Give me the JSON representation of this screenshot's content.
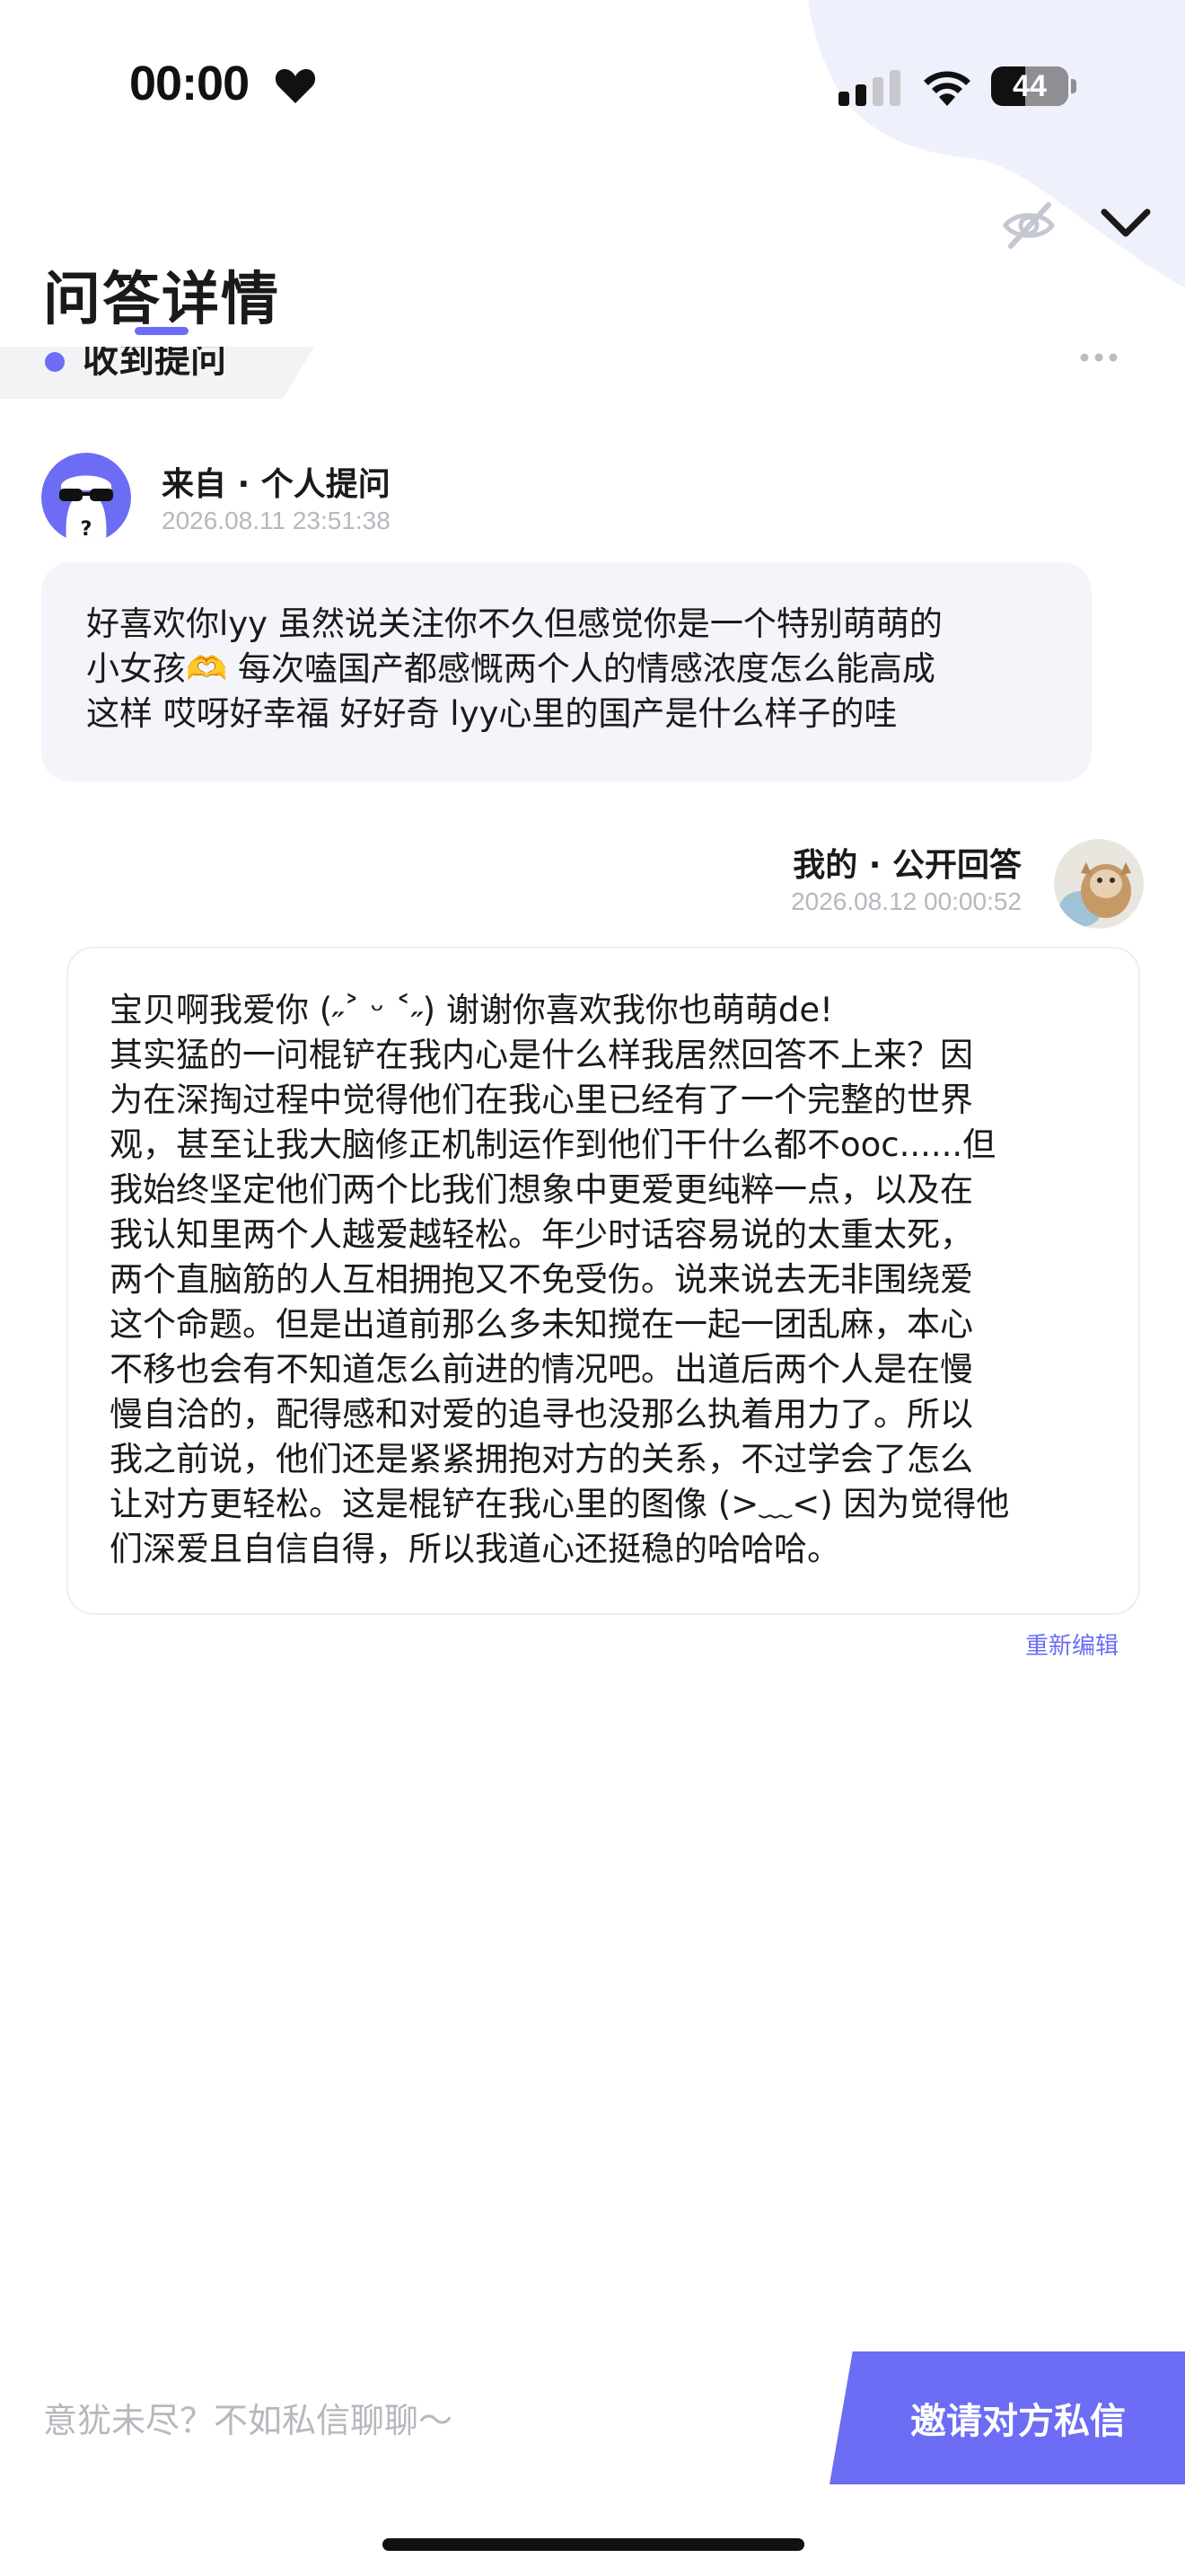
{
  "status_bar": {
    "time": "00:00",
    "battery_level": "44",
    "icons": [
      "heart-icon",
      "signal-icon",
      "wifi-icon",
      "battery-icon"
    ]
  },
  "header": {
    "title": "问答详情",
    "icons": [
      "eye-off-icon",
      "chevron-down-icon"
    ],
    "accent_color": "#6c6cf5"
  },
  "status_tab": {
    "label": "收到提问"
  },
  "question": {
    "source": "来自 · 个人提问",
    "time": "2026.08.11 23:51:38",
    "text": "好喜欢你lyy 虽然说关注你不久但感觉你是一个特别萌萌的\n小女孩🫶 每次嗑国产都感慨两个人的情感浓度怎么能高成\n这样 哎呀好幸福 好好奇 lyy心里的国产是什么样子的哇"
  },
  "answer": {
    "label": "我的 · 公开回答",
    "time": "2026.08.12 00:00:52",
    "text": "宝贝啊我爱你 (˶˃ ᵕ ˂˶) 谢谢你喜欢我你也萌萌de!\n其实猛的一问棍铲在我内心是什么样我居然回答不上来？因\n为在深掏过程中觉得他们在我心里已经有了一个完整的世界\n观，甚至让我大脑修正机制运作到他们干什么都不ooc......但\n我始终坚定他们两个比我们想象中更爱更纯粹一点，以及在\n我认知里两个人越爱越轻松。年少时话容易说的太重太死，\n两个直脑筋的人互相拥抱又不免受伤。说来说去无非围绕爱\n这个命题。但是出道前那么多未知搅在一起一团乱麻，本心\n不移也会有不知道怎么前进的情况吧。出道后两个人是在慢\n慢自洽的，配得感和对爱的追寻也没那么执着用力了。所以\n我之前说，他们还是紧紧拥抱对方的关系，不过学会了怎么\n让对方更轻松。这是棍铲在我心里的图像 (>﹏<) 因为觉得他\n们深爱且自信自得，所以我道心还挺稳的哈哈哈。",
    "edit_label": "重新编辑"
  },
  "bottom_bar": {
    "prompt": "意犹未尽？不如私信聊聊～",
    "invite_label": "邀请对方私信"
  }
}
